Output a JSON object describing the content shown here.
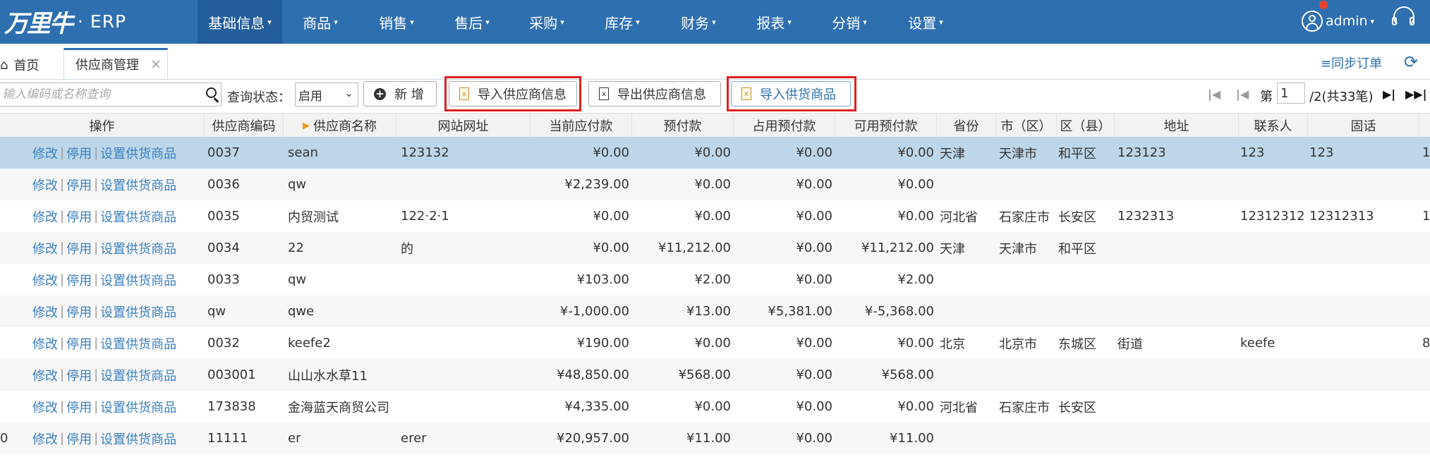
{
  "app": {
    "logo_mark": "万里牛",
    "logo_text": "· ERP"
  },
  "nav": {
    "items": [
      {
        "label": "基础信息",
        "active": true
      },
      {
        "label": "商品"
      },
      {
        "label": "销售"
      },
      {
        "label": "售后"
      },
      {
        "label": "采购"
      },
      {
        "label": "库存"
      },
      {
        "label": "财务"
      },
      {
        "label": "报表"
      },
      {
        "label": "分销"
      },
      {
        "label": "设置"
      }
    ],
    "user": "admin",
    "accent_color": "#2e6fb0"
  },
  "tabs": {
    "home": "首页",
    "active": "供应商管理",
    "close": "×",
    "sync_orders": "≡同步订单"
  },
  "toolbar": {
    "search_placeholder": "输入编码或名称查询",
    "status_label": "查询状态：",
    "status_value": "启用",
    "add_label": "新 增",
    "import_supplier_label": "导入供应商信息",
    "export_supplier_label": "导出供应商信息",
    "import_goods_label": "导入供货商品"
  },
  "pager": {
    "page_prefix": "第",
    "current_page": "1",
    "page_suffix": "/2(共33笔)"
  },
  "table": {
    "headers": {
      "ops": "操作",
      "code": "供应商编码",
      "name": "供应商名称",
      "website": "网站网址",
      "payable": "当前应付款",
      "prepay": "预付款",
      "used_prepay": "占用预付款",
      "avail_prepay": "可用预付款",
      "province": "省份",
      "city": "市（区）",
      "district": "区（县）",
      "address": "地址",
      "contact": "联系人",
      "phone": "固话"
    },
    "action_labels": {
      "edit": "修改",
      "disable": "停用",
      "set_goods": "设置供货商品",
      "sep": "|"
    },
    "rows": [
      {
        "edge": "",
        "code": "0037",
        "name": "sean",
        "website": "123132",
        "payable": "¥0.00",
        "prepay": "¥0.00",
        "used": "¥0.00",
        "avail": "¥0.00",
        "province": "天津",
        "city": "天津市",
        "district": "和平区",
        "address": "123123",
        "contact": "123",
        "phone": "123",
        "extra": "1"
      },
      {
        "edge": "",
        "code": "0036",
        "name": "qw",
        "website": "",
        "payable": "¥2,239.00",
        "prepay": "¥0.00",
        "used": "¥0.00",
        "avail": "¥0.00",
        "province": "",
        "city": "",
        "district": "",
        "address": "",
        "contact": "",
        "phone": "",
        "extra": ""
      },
      {
        "edge": "",
        "code": "0035",
        "name": "内贸测试",
        "website": "122·2·1",
        "payable": "¥0.00",
        "prepay": "¥0.00",
        "used": "¥0.00",
        "avail": "¥0.00",
        "province": "河北省",
        "city": "石家庄市",
        "district": "长安区",
        "address": "1232313",
        "contact": "12312312",
        "phone": "12312313",
        "extra": "1"
      },
      {
        "edge": "",
        "code": "0034",
        "name": "22",
        "website": "的",
        "payable": "¥0.00",
        "prepay": "¥11,212.00",
        "used": "¥0.00",
        "avail": "¥11,212.00",
        "province": "天津",
        "city": "天津市",
        "district": "和平区",
        "address": "",
        "contact": "",
        "phone": "",
        "extra": ""
      },
      {
        "edge": "",
        "code": "0033",
        "name": "qw",
        "website": "",
        "payable": "¥103.00",
        "prepay": "¥2.00",
        "used": "¥0.00",
        "avail": "¥2.00",
        "province": "",
        "city": "",
        "district": "",
        "address": "",
        "contact": "",
        "phone": "",
        "extra": ""
      },
      {
        "edge": "",
        "code": "qw",
        "name": "qwe",
        "website": "",
        "payable": "¥-1,000.00",
        "prepay": "¥13.00",
        "used": "¥5,381.00",
        "avail": "¥-5,368.00",
        "province": "",
        "city": "",
        "district": "",
        "address": "",
        "contact": "",
        "phone": "",
        "extra": ""
      },
      {
        "edge": "",
        "code": "0032",
        "name": "keefe2",
        "website": "",
        "payable": "¥190.00",
        "prepay": "¥0.00",
        "used": "¥0.00",
        "avail": "¥0.00",
        "province": "北京",
        "city": "北京市",
        "district": "东城区",
        "address": "街道",
        "contact": "keefe",
        "phone": "",
        "extra": "8"
      },
      {
        "edge": "",
        "code": "003001",
        "name": "山山水水草11",
        "website": "",
        "payable": "¥48,850.00",
        "prepay": "¥568.00",
        "used": "¥0.00",
        "avail": "¥568.00",
        "province": "",
        "city": "",
        "district": "",
        "address": "",
        "contact": "",
        "phone": "",
        "extra": ""
      },
      {
        "edge": "",
        "code": "173838",
        "name": "金海蓝天商贸公司",
        "website": "",
        "payable": "¥4,335.00",
        "prepay": "¥0.00",
        "used": "¥0.00",
        "avail": "¥0.00",
        "province": "河北省",
        "city": "石家庄市",
        "district": "长安区",
        "address": "",
        "contact": "",
        "phone": "",
        "extra": ""
      },
      {
        "edge": "0",
        "code": "11111",
        "name": "er",
        "website": "erer",
        "payable": "¥20,957.00",
        "prepay": "¥11.00",
        "used": "¥0.00",
        "avail": "¥11.00",
        "province": "",
        "city": "",
        "district": "",
        "address": "",
        "contact": "",
        "phone": "",
        "extra": ""
      }
    ]
  }
}
